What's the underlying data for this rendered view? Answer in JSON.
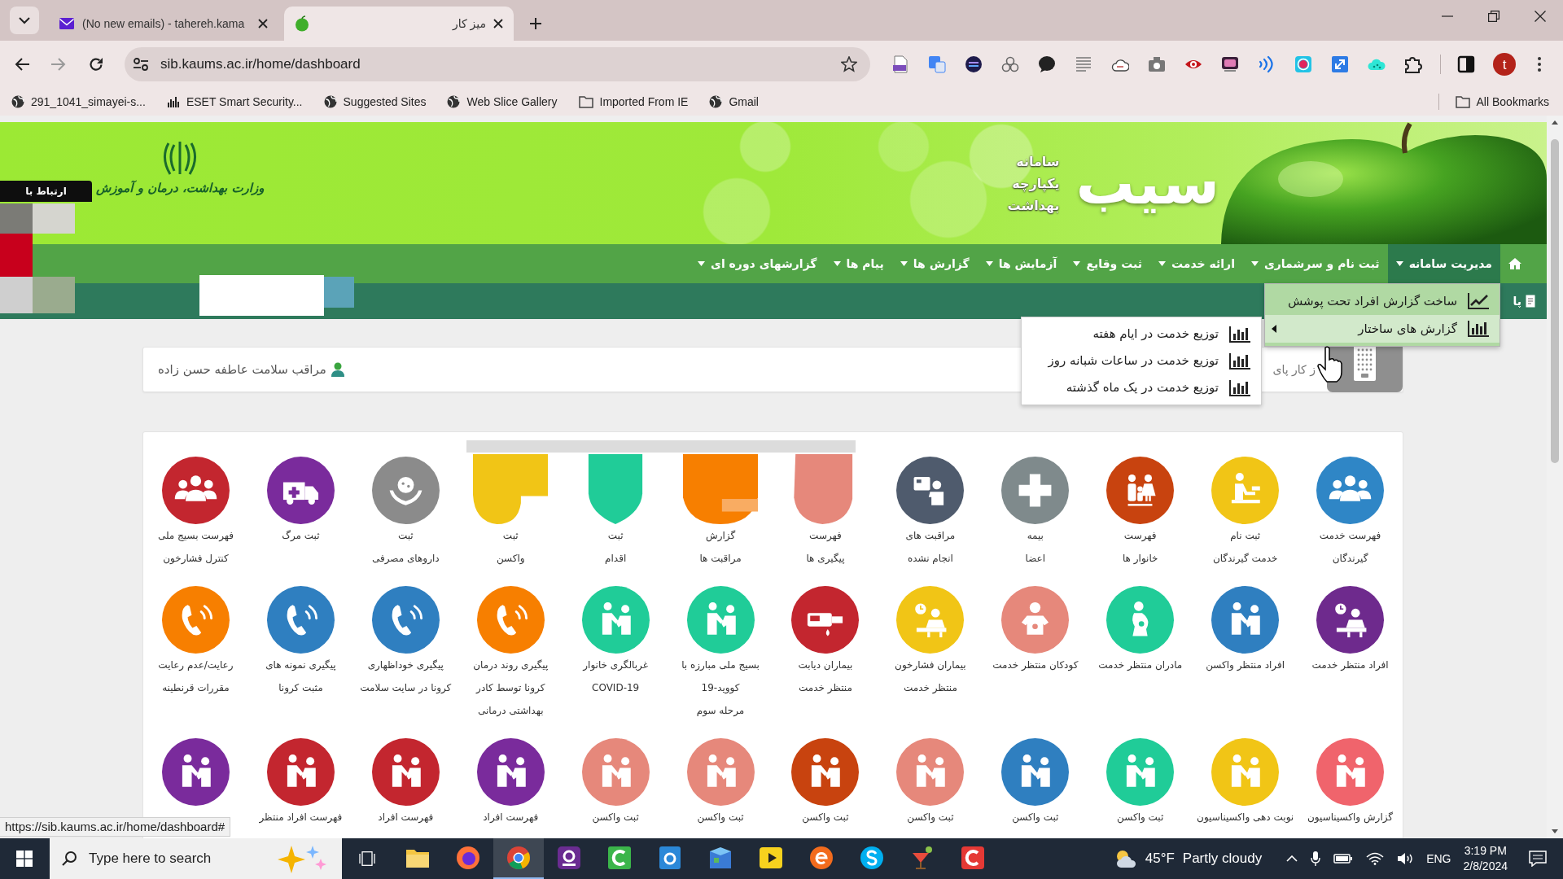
{
  "browser": {
    "tabs": [
      {
        "title": "میز کار",
        "kind": "apple",
        "selected": true
      },
      {
        "title": "(No new emails) - tahereh.kama",
        "kind": "mail",
        "selected": false
      }
    ],
    "address": "sib.kaums.ac.ir/home/dashboard",
    "bookmarks": [
      {
        "label": "Gmail",
        "kind": "globe"
      },
      {
        "label": "Imported From IE",
        "kind": "folder"
      },
      {
        "label": "Web Slice Gallery",
        "kind": "globe"
      },
      {
        "label": "Suggested Sites",
        "kind": "globe"
      },
      {
        "label": "ESET Smart Security...",
        "kind": "bars"
      },
      {
        "label": "291_1041_simayei-s...",
        "kind": "globe"
      }
    ],
    "all_bookmarks": "All Bookmarks",
    "profile_initial": "t"
  },
  "banner": {
    "logo": "سیب",
    "tagline": [
      "سامانه",
      "یکپارچه",
      "بهداشت"
    ],
    "ministry": "وزارت بهداشت، درمان و آموزش"
  },
  "contact_tab": "ارتباط با",
  "nav": {
    "items": [
      {
        "label": "مدیریت سامانه",
        "selected": true
      },
      {
        "label": "ثبت نام و سرشماری",
        "selected": false
      },
      {
        "label": "ارائه خدمت",
        "selected": false
      },
      {
        "label": "ثبت وقایع",
        "selected": false
      },
      {
        "label": "آزمایش ها",
        "selected": false
      },
      {
        "label": "گزارش ها",
        "selected": false
      },
      {
        "label": "پیام ها",
        "selected": false
      },
      {
        "label": "گزارشهای دوره ای",
        "selected": false
      }
    ]
  },
  "sub_nav": {
    "label": "پا"
  },
  "menu": {
    "items": [
      {
        "label": "ساخت گزارش افراد تحت پوشش",
        "kind": "line",
        "selected": false,
        "has_submenu": false
      },
      {
        "label": "گزارش های ساختار",
        "kind": "bars",
        "selected": true,
        "has_submenu": true
      }
    ]
  },
  "submenu": {
    "items": [
      {
        "label": "توزیع خدمت در ایام هفته"
      },
      {
        "label": "توزیع خدمت در ساعات شبانه روز"
      },
      {
        "label": "توزیع خدمت در یک ماه گذشته"
      }
    ]
  },
  "info": {
    "user": "مراقب سلامت عاطفه حسن زاده",
    "desk": "ز کار پای"
  },
  "tiles": [
    {
      "lines": [
        "فهرست خدمت",
        "گیرندگان"
      ],
      "color": "#2f86c6",
      "kind": "people"
    },
    {
      "lines": [
        "ثبت نام",
        "خدمت گیرندگان"
      ],
      "color": "#f1c516",
      "kind": "counter"
    },
    {
      "lines": [
        "فهرست",
        "خانوار ها"
      ],
      "color": "#c8430f",
      "kind": "family"
    },
    {
      "lines": [
        "بیمه",
        "اعضا"
      ],
      "color": "#7f8a8c",
      "kind": "plus"
    },
    {
      "lines": [
        "مراقبت های",
        "انجام نشده"
      ],
      "color": "#4f5b6d",
      "kind": "board"
    },
    {
      "lines": [
        "فهرست",
        "پیگیری ها"
      ],
      "color": "#e6887b",
      "kind": "tab"
    },
    {
      "lines": [
        "گزارش",
        "مراقبت ها"
      ],
      "color": "#f77f00",
      "kind": "block"
    },
    {
      "lines": [
        "ثبت",
        "اقدام"
      ],
      "color": "#20cc98",
      "kind": "shield"
    },
    {
      "lines": [
        "ثبت",
        "واکسن"
      ],
      "color": "#f1c516",
      "kind": "notch"
    },
    {
      "lines": [
        "ثبت",
        "داروهای مصرفی"
      ],
      "color": "#8b8b8b",
      "kind": "hands"
    },
    {
      "lines": [
        "ثبت مرگ"
      ],
      "color": "#7a2b9c",
      "kind": "ambulance"
    },
    {
      "lines": [
        "فهرست بسیج ملی",
        "کنترل فشارخون"
      ],
      "color": "#c3262f",
      "kind": "people"
    },
    {
      "lines": [
        "افراد منتظر خدمت"
      ],
      "color": "#6e2a8d",
      "kind": "clock"
    },
    {
      "lines": [
        "افراد منتظر واکسن"
      ],
      "color": "#2f7fc0",
      "kind": "care"
    },
    {
      "lines": [
        "مادران منتظر خدمت"
      ],
      "color": "#20cc98",
      "kind": "mother"
    },
    {
      "lines": [
        "کودکان منتظر خدمت"
      ],
      "color": "#e6887b",
      "kind": "baby"
    },
    {
      "lines": [
        "بیماران فشارخون",
        "منتظر خدمت"
      ],
      "color": "#f1c516",
      "kind": "clock"
    },
    {
      "lines": [
        "بیماران دیابت",
        "منتظر خدمت"
      ],
      "color": "#c3262f",
      "kind": "meter"
    },
    {
      "lines": [
        "بسیج ملی مبارزه با",
        "کووید-19",
        "مرحله سوم"
      ],
      "color": "#20cc98",
      "kind": "care"
    },
    {
      "lines": [
        "غربالگری خانوار",
        "COVID-19"
      ],
      "color": "#20cc98",
      "kind": "care"
    },
    {
      "lines": [
        "پیگیری روند درمان",
        "کرونا توسط کادر",
        "بهداشتی درمانی"
      ],
      "color": "#f77f00",
      "kind": "phone"
    },
    {
      "lines": [
        "پیگیری خوداظهاری",
        "کرونا در سایت سلامت"
      ],
      "color": "#2f7fc0",
      "kind": "phone"
    },
    {
      "lines": [
        "پیگیری نمونه های",
        "مثبت کرونا"
      ],
      "color": "#2f7fc0",
      "kind": "phone"
    },
    {
      "lines": [
        "رعایت/عدم رعایت",
        "مقررات قرنطینه"
      ],
      "color": "#f77f00",
      "kind": "phone"
    },
    {
      "lines": [
        "گزارش واکسیناسیون"
      ],
      "color": "#f0646c",
      "kind": "care"
    },
    {
      "lines": [
        "نوبت دهی واکسیناسیون"
      ],
      "color": "#f1c516",
      "kind": "care"
    },
    {
      "lines": [
        "ثبت واکسن"
      ],
      "color": "#20cc98",
      "kind": "care"
    },
    {
      "lines": [
        "ثبت واکسن"
      ],
      "color": "#2f7fc0",
      "kind": "care"
    },
    {
      "lines": [
        "ثبت واکسن"
      ],
      "color": "#e6887b",
      "kind": "care"
    },
    {
      "lines": [
        "ثبت واکسن"
      ],
      "color": "#c8430f",
      "kind": "care"
    },
    {
      "lines": [
        "ثبت واکسن"
      ],
      "color": "#e6887b",
      "kind": "care"
    },
    {
      "lines": [
        "ثبت واکسن"
      ],
      "color": "#e6887b",
      "kind": "care"
    },
    {
      "lines": [
        "فهرست افراد"
      ],
      "color": "#7a2b9c",
      "kind": "care"
    },
    {
      "lines": [
        "فهرست افراد"
      ],
      "color": "#c3262f",
      "kind": "care"
    },
    {
      "lines": [
        "فهرست افراد منتظر"
      ],
      "color": "#c3262f",
      "kind": "care"
    },
    {
      "color": "#7a2b9c",
      "kind": "care"
    }
  ],
  "status_url": "https://sib.kaums.ac.ir/home/dashboard#",
  "taskbar": {
    "search_placeholder": "Type here to search",
    "apps": [
      {
        "kind": "folder",
        "selected": false
      },
      {
        "kind": "fox",
        "selected": false
      },
      {
        "kind": "ring",
        "selected": true
      },
      {
        "kind": "pdf",
        "selected": false
      },
      {
        "kind": "camtasia",
        "selected": false
      },
      {
        "kind": "notes",
        "selected": false
      },
      {
        "kind": "cube",
        "selected": false
      },
      {
        "kind": "player",
        "selected": false
      },
      {
        "kind": "edge",
        "selected": false
      },
      {
        "kind": "skype",
        "selected": false
      },
      {
        "kind": "drink",
        "selected": false
      },
      {
        "kind": "recorder",
        "selected": false
      }
    ],
    "temperature": "45°F",
    "weather": "Partly cloudy",
    "language": "ENG",
    "time": "3:19 PM",
    "date": "2/8/2024"
  }
}
